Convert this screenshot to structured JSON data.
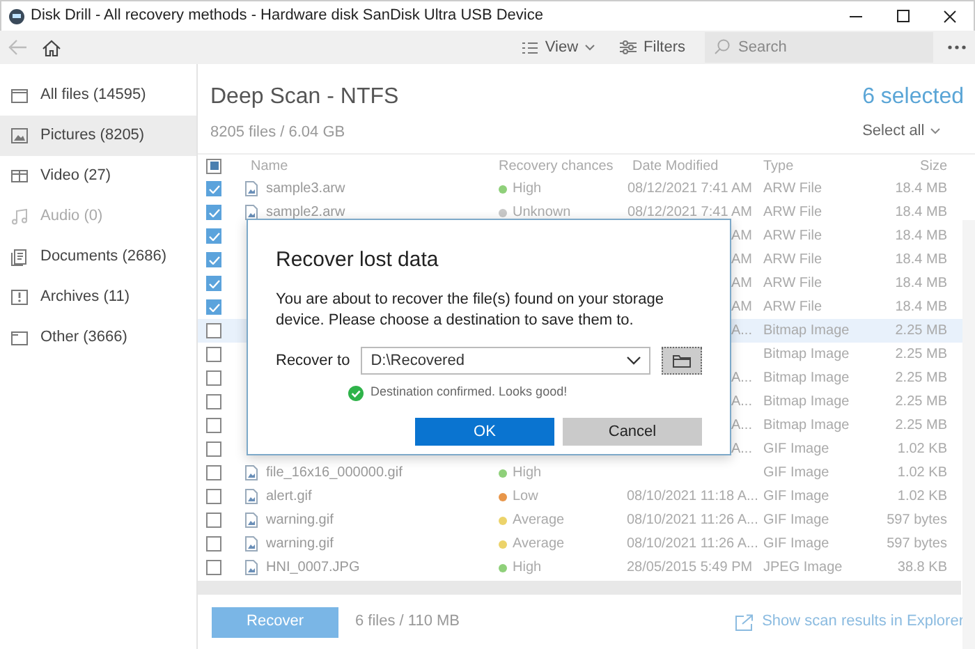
{
  "window": {
    "title": "Disk Drill - All recovery methods - Hardware disk SanDisk Ultra USB Device"
  },
  "toolbar": {
    "back_disabled": true,
    "view_label": "View",
    "filters_label": "Filters",
    "search": {
      "placeholder": "Search"
    }
  },
  "sidebar": {
    "items": [
      {
        "label": "All files (14595)",
        "kind": "all",
        "selected": false,
        "disabled": false
      },
      {
        "label": "Pictures (8205)",
        "kind": "pictures",
        "selected": true,
        "disabled": false
      },
      {
        "label": "Video (27)",
        "kind": "video",
        "selected": false,
        "disabled": false
      },
      {
        "label": "Audio (0)",
        "kind": "audio",
        "selected": false,
        "disabled": true
      },
      {
        "label": "Documents (2686)",
        "kind": "documents",
        "selected": false,
        "disabled": false
      },
      {
        "label": "Archives (11)",
        "kind": "archives",
        "selected": false,
        "disabled": false
      },
      {
        "label": "Other (3666)",
        "kind": "other",
        "selected": false,
        "disabled": false
      }
    ]
  },
  "header": {
    "title": "Deep Scan - NTFS",
    "subtitle": "8205 files / 6.04 GB",
    "selected_count": "6 selected",
    "select_all": "Select all"
  },
  "table": {
    "select_all_mixed": true,
    "columns": [
      "Name",
      "Recovery chances",
      "Date Modified",
      "Type",
      "Size"
    ],
    "rows": [
      {
        "checked": true,
        "highlighted": false,
        "name": "sample3.arw",
        "recovery": "High",
        "color": "#8fd07a",
        "date": "08/12/2021 7:41 AM",
        "type": "ARW File",
        "size": "18.4 MB"
      },
      {
        "checked": true,
        "highlighted": false,
        "name": "sample2.arw",
        "recovery": "Unknown",
        "color": "#c8c8c8",
        "date": "08/12/2021 7:41 AM",
        "type": "ARW File",
        "size": "18.4 MB"
      },
      {
        "checked": true,
        "highlighted": false,
        "date": "AM",
        "type": "ARW File",
        "size": "18.4 MB"
      },
      {
        "checked": true,
        "highlighted": false,
        "date": "AM",
        "type": "ARW File",
        "size": "18.4 MB"
      },
      {
        "checked": true,
        "highlighted": false,
        "date": "AM",
        "type": "ARW File",
        "size": "18.4 MB"
      },
      {
        "checked": true,
        "highlighted": false,
        "date": "AM",
        "type": "ARW File",
        "size": "18.4 MB"
      },
      {
        "checked": false,
        "highlighted": true,
        "date": "A...",
        "type": "Bitmap Image",
        "size": "2.25 MB"
      },
      {
        "checked": false,
        "highlighted": false,
        "type": "Bitmap Image",
        "size": "2.25 MB"
      },
      {
        "checked": false,
        "highlighted": false,
        "date": "A...",
        "type": "Bitmap Image",
        "size": "2.25 MB"
      },
      {
        "checked": false,
        "highlighted": false,
        "date": "A...",
        "type": "Bitmap Image",
        "size": "2.25 MB"
      },
      {
        "checked": false,
        "highlighted": false,
        "date": "A...",
        "type": "Bitmap Image",
        "size": "2.25 MB"
      },
      {
        "checked": false,
        "highlighted": false,
        "date": "A...",
        "type": "GIF Image",
        "size": "1.02 KB"
      },
      {
        "checked": false,
        "highlighted": false,
        "name": "file_16x16_000000.gif",
        "recovery": "High",
        "color": "#8fd07a",
        "type": "GIF Image",
        "size": "1.02 KB"
      },
      {
        "checked": false,
        "highlighted": false,
        "name": "alert.gif",
        "recovery": "Low",
        "color": "#e8964a",
        "date": "08/10/2021 11:18 A...",
        "type": "GIF Image",
        "size": "1.02 KB"
      },
      {
        "checked": false,
        "highlighted": false,
        "name": "warning.gif",
        "recovery": "Average",
        "color": "#ecd36a",
        "date": "08/10/2021 11:26 A...",
        "type": "GIF Image",
        "size": "597 bytes"
      },
      {
        "checked": false,
        "highlighted": false,
        "name": "warning.gif",
        "recovery": "Average",
        "color": "#ecd36a",
        "date": "08/10/2021 11:26 A...",
        "type": "GIF Image",
        "size": "597 bytes"
      },
      {
        "checked": false,
        "highlighted": false,
        "name": "HNI_0007.JPG",
        "recovery": "High",
        "color": "#8fd07a",
        "date": "28/05/2015 5:49 PM",
        "type": "JPEG Image",
        "size": "38.8 KB"
      }
    ]
  },
  "footer": {
    "recover_button": "Recover",
    "summary": "6 files / 110 MB",
    "explorer_link": "Show scan results in Explorer"
  },
  "dialog": {
    "title": "Recover lost data",
    "message": "You are about to recover the file(s) found on your storage device. Please choose a destination to save them to.",
    "recover_to_label": "Recover to",
    "destination": "D:\\Recovered",
    "confirmation": "Destination confirmed. Looks good!",
    "ok": "OK",
    "cancel": "Cancel"
  }
}
